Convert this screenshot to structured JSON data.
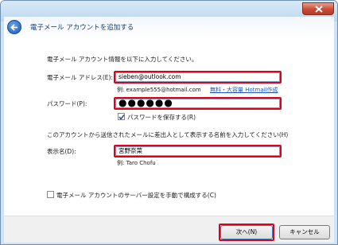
{
  "header": {
    "title": "電子メール アカウントを追加する"
  },
  "form": {
    "intro": "電子メール アカウント情報を以下に入力してください。",
    "email_label": "電子メール アドレス(E):",
    "email_value": "sieben@outlook.com",
    "email_example": "例: example555@hotmail.com",
    "hotmail_link": "無料・大容量 Hotmail作成",
    "password_label": "パスワード(P):",
    "password_value": "●●●●●●",
    "save_password_label": "パスワードを保存する(R)",
    "save_password_checked": true,
    "display_intro": "このアカウントから送信されたメールに差出人として表示する名前を入力してください(H)",
    "display_label": "表示名(D):",
    "display_value": "宮野奈菜",
    "display_example": "例: Taro Chofu",
    "manual_config_label": "電子メール アカウントのサーバー設定を手動で構成する(C)",
    "manual_config_checked": false
  },
  "footer": {
    "next_label": "次へ(N)",
    "cancel_label": "キャンセル"
  },
  "colors": {
    "highlight": "#e0001b",
    "link": "#1f56c6",
    "title_text": "#1b3a73"
  }
}
